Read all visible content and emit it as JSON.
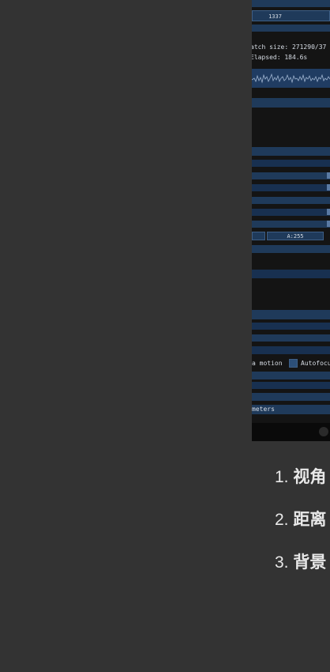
{
  "panel": {
    "seed_value": "1337",
    "batch_size_text": "atch size: 271290/37",
    "elapsed_text": "Elapsed: 184.6s",
    "alpha_value": "A:255",
    "motion_label": "a motion",
    "autofocus_label": "Autofocu",
    "parameters_label": "meters"
  },
  "list": {
    "items": [
      {
        "number": "1.",
        "text": "视角"
      },
      {
        "number": "2.",
        "text": "距离"
      },
      {
        "number": "3.",
        "text": "背景"
      }
    ]
  }
}
